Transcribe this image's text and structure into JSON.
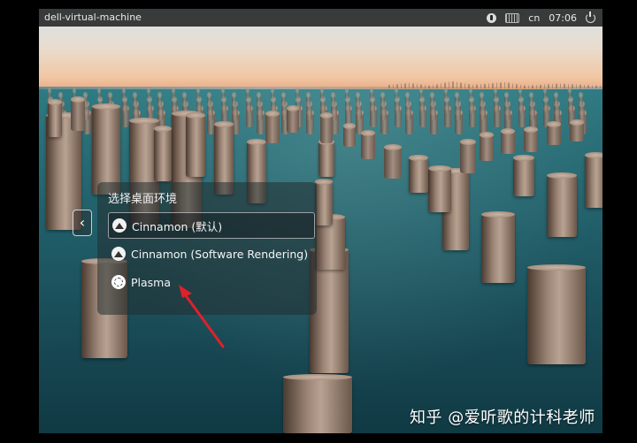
{
  "topbar": {
    "hostname": "dell-virtual-machine",
    "language": "cn",
    "time": "07:06",
    "icons": [
      "accessibility-icon",
      "keyboard-icon",
      "power-icon"
    ]
  },
  "session_chooser": {
    "title": "选择桌面环境",
    "back_icon": "chevron-left-icon",
    "sessions": [
      {
        "label": "Cinnamon (默认)",
        "icon": "cinnamon-icon",
        "selected": true
      },
      {
        "label": "Cinnamon (Software Rendering)",
        "icon": "cinnamon-icon",
        "selected": false
      },
      {
        "label": "Plasma",
        "icon": "plasma-icon",
        "selected": false
      }
    ]
  },
  "annotation": {
    "arrow_color": "#e0202a",
    "points_to": "Plasma"
  },
  "watermark": "知乎 @爱听歌的计科老师"
}
